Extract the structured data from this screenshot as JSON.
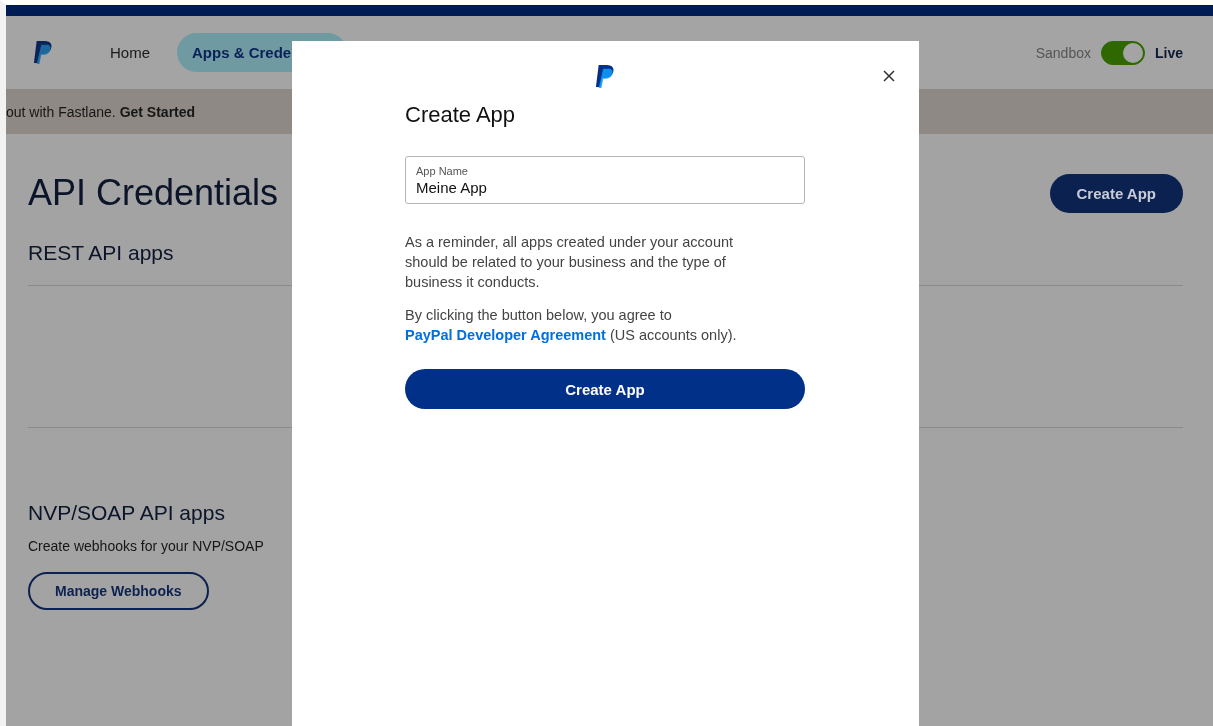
{
  "top_nav": {
    "items": [
      {
        "label": "Home",
        "selected": false
      },
      {
        "label": "Apps & Crede",
        "selected": true
      }
    ],
    "environment": {
      "off_label": "Sandbox",
      "on_label": "Live",
      "on": true
    }
  },
  "banner": {
    "text": "out with Fastlane. **Get Started**"
  },
  "page": {
    "title": "API Credentials",
    "create_button": "Create App",
    "sections": [
      {
        "title": "REST API apps"
      },
      {
        "title": "NVP/SOAP API apps",
        "description": "Create webhooks for your NVP/SOAP",
        "button": "Manage Webhooks"
      }
    ]
  },
  "dialog": {
    "title": "Create App",
    "field": {
      "label": "App Name",
      "value": "Meine App"
    },
    "paragraphs": [
      "As a reminder, all apps created under your account should be related to your business and the type of business it conducts."
    ],
    "agreement": {
      "before": "By clicking the button below, you agree to ",
      "link": "PayPal Developer Agreement",
      "after": " (US accounts only)."
    },
    "submit": "Create App"
  }
}
